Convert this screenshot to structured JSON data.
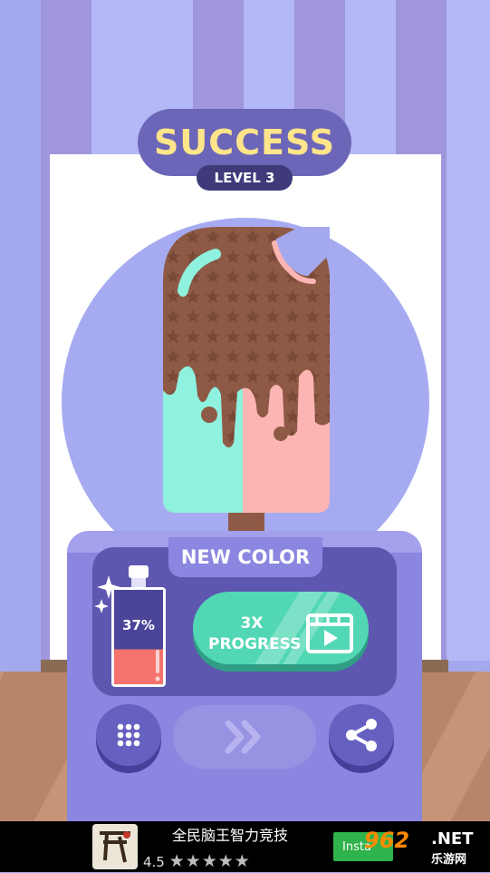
{
  "header": {
    "title": "SUCCESS",
    "level": "LEVEL 3"
  },
  "reward_panel": {
    "tab_label": "NEW COLOR",
    "paint_progress": "37%",
    "paint_progress_value": 0.37,
    "progress_button": {
      "line1": "3X",
      "line2": "PROGRESS",
      "icon": "video-play-icon"
    }
  },
  "controls": {
    "menu_icon": "grid-menu-icon",
    "next_icon": "double-chevron-right-icon",
    "share_icon": "share-icon"
  },
  "ad": {
    "title": "全民脑王智力竞技",
    "rating": "4.5",
    "stars": 4.5,
    "install_label": "Insta",
    "watermark": "962",
    "watermark_suffix": ".NET",
    "watermark_sub": "乐游网"
  },
  "colors": {
    "title_text": "#ffe58a",
    "chocolate": "#8e5a46",
    "mint": "#8ef2df",
    "pink": "#fdb5b3",
    "button_green": "#52d7b4",
    "panel": "#8b86df",
    "panel_inner": "#5d57b0"
  }
}
